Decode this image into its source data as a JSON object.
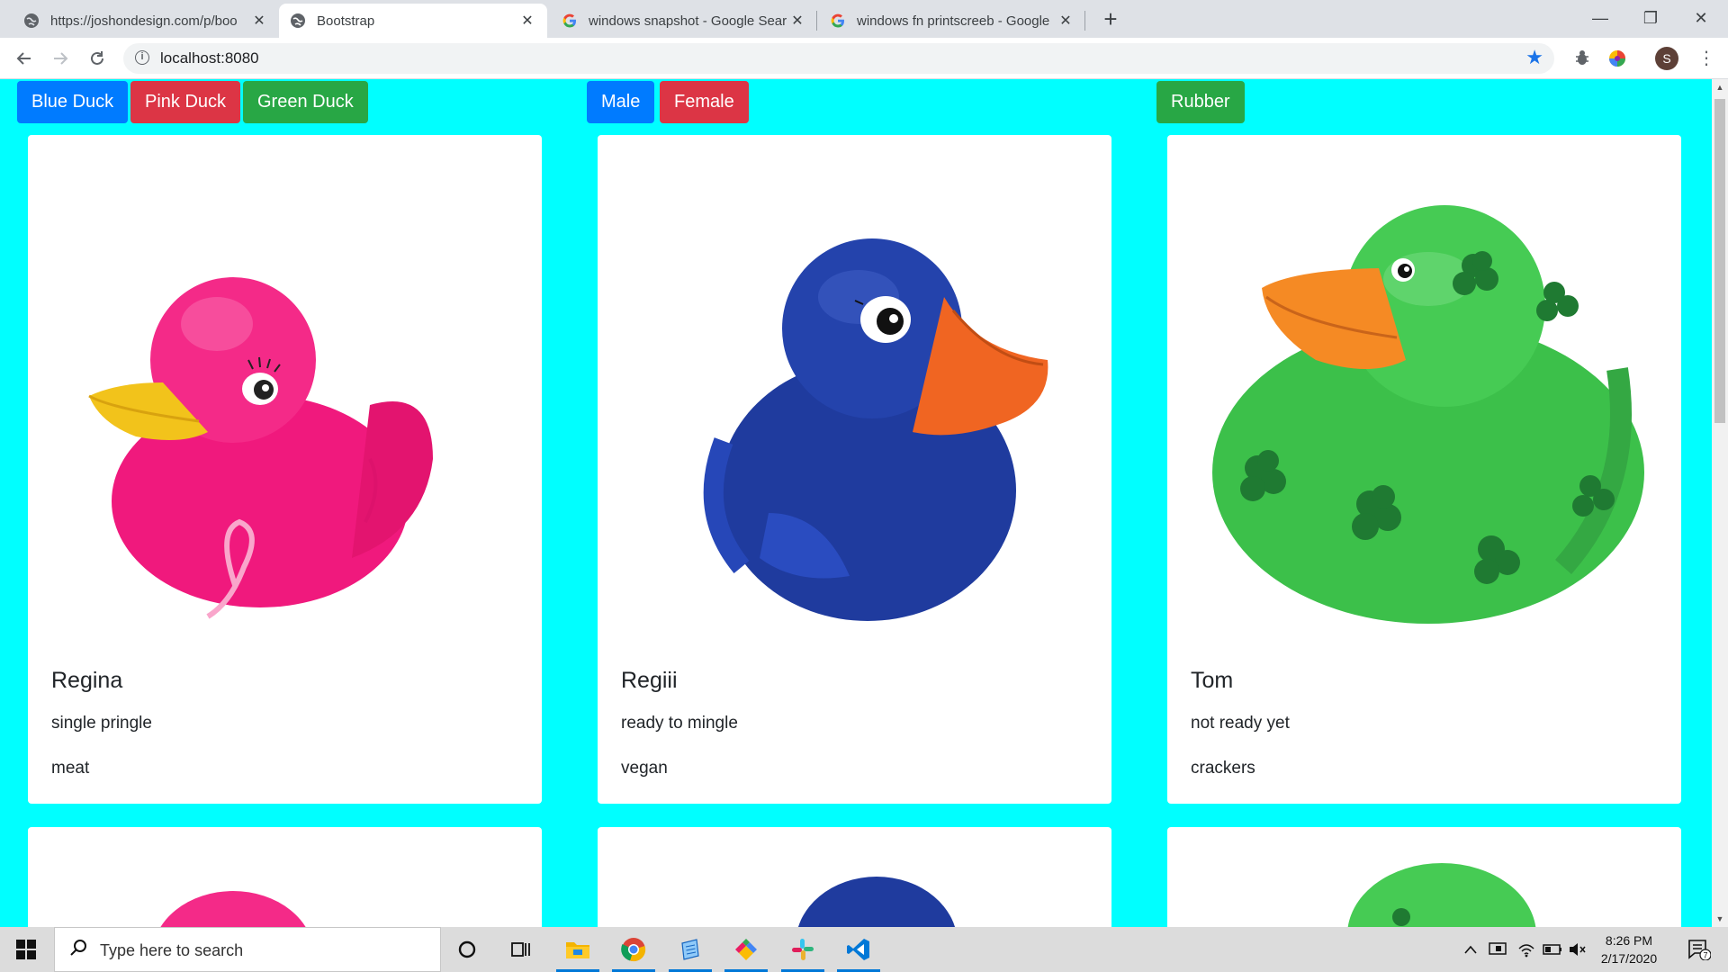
{
  "browser": {
    "tabs": [
      {
        "title": "https://joshondesign.com/p/boo",
        "active": false,
        "favicon": "globe-icon"
      },
      {
        "title": "Bootstrap",
        "active": true,
        "favicon": "globe-icon"
      },
      {
        "title": "windows snapshot - Google Sear",
        "active": false,
        "favicon": "google-icon"
      },
      {
        "title": "windows fn printscreeb - Google",
        "active": false,
        "favicon": "google-icon"
      }
    ],
    "new_tab": "+",
    "window_controls": {
      "minimize": "—",
      "restore": "❐",
      "close": "✕"
    },
    "url": "localhost:8080",
    "avatar_initial": "S"
  },
  "page": {
    "background": "#00ffff",
    "filters": [
      {
        "label": "Blue Duck",
        "color": "#007bff"
      },
      {
        "label": "Pink Duck",
        "color": "#dc3545"
      },
      {
        "label": "Green Duck",
        "color": "#28a745"
      },
      {
        "label": "Male",
        "color": "#007bff"
      },
      {
        "label": "Female",
        "color": "#dc3545"
      },
      {
        "label": "Rubber",
        "color": "#28a745"
      }
    ],
    "cards": [
      {
        "name": "Regina",
        "desc": "single pringle",
        "food": "meat",
        "duck": "pink-duck",
        "duck_color": "#f0197d"
      },
      {
        "name": "Regiii",
        "desc": "ready to mingle",
        "food": "vegan",
        "duck": "blue-duck",
        "duck_color": "#1f3b9e"
      },
      {
        "name": "Tom",
        "desc": "not ready yet",
        "food": "crackers",
        "duck": "green-duck",
        "duck_color": "#3cc04a"
      }
    ]
  },
  "taskbar": {
    "search_placeholder": "Type here to search",
    "time": "8:26 PM",
    "date": "2/17/2020",
    "notification_count": "7",
    "apps": [
      "cortana-icon",
      "task-view-icon",
      "file-explorer-icon",
      "chrome-icon",
      "notepad-icon",
      "colorful-app-icon",
      "slack-icon",
      "vscode-icon"
    ]
  }
}
